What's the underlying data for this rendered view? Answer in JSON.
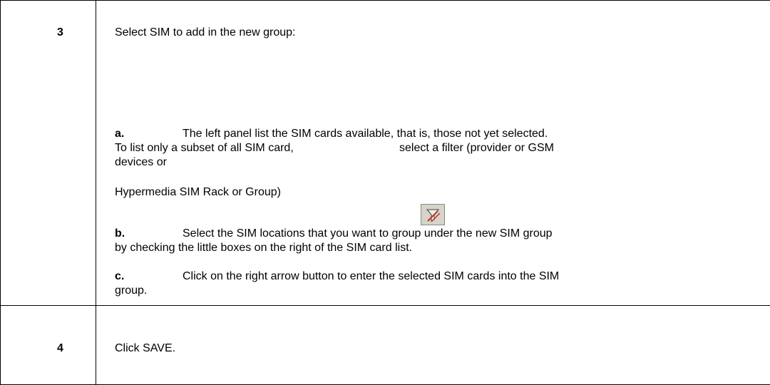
{
  "steps": [
    {
      "number": "3",
      "heading": "Select SIM to add in the new group:",
      "a_label": "a.",
      "a_line1": "The left panel list the SIM cards available, that is, those not yet selected.",
      "a_line2_left": "To list only a subset of all SIM card,",
      "a_line2_right": "select  a  filter  (provider  or  GSM",
      "a_line3": "devices or",
      "a_line4": "Hypermedia SIM Rack or Group)",
      "b_label": "b.",
      "b_line1": "Select the SIM locations that you want to group under the new SIM group",
      "b_line2": "by checking the little boxes on the right of the SIM card list.",
      "c_label": "c.",
      "c_line1": "Click on the right arrow button to enter the selected SIM cards into the SIM",
      "c_line2": "group."
    },
    {
      "number": "4",
      "text": "Click SAVE."
    }
  ],
  "icons": {
    "filter": "filter-icon"
  }
}
